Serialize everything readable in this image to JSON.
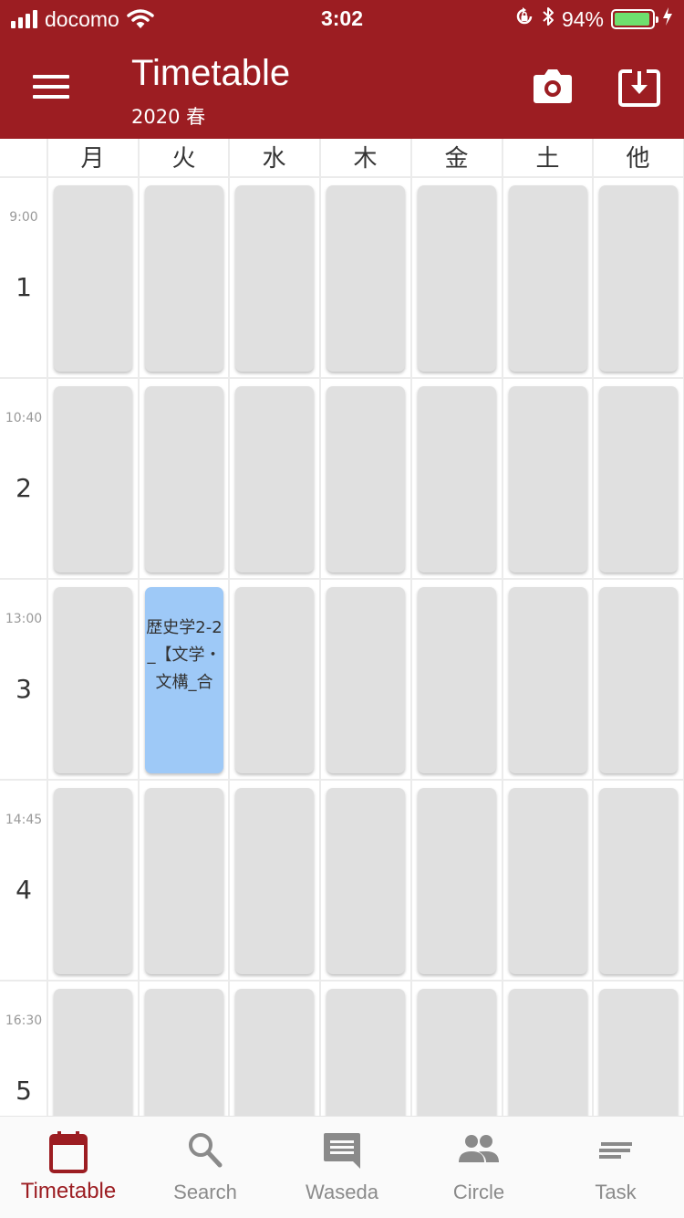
{
  "status_bar": {
    "carrier": "docomo",
    "time": "3:02",
    "battery_percent": "94%",
    "battery_level": 0.94,
    "icons": [
      "signal-icon",
      "wifi-icon",
      "rotation-lock-icon",
      "bluetooth-icon",
      "battery-icon",
      "charging-icon"
    ]
  },
  "app_bar": {
    "title": "Timetable",
    "subtitle": "2020 春",
    "background": "#9c1d22",
    "icons": [
      "menu-icon",
      "camera-icon",
      "download-icon"
    ]
  },
  "days": [
    "月",
    "火",
    "水",
    "木",
    "金",
    "土",
    "他"
  ],
  "periods": [
    {
      "number": "1",
      "start": "9:00"
    },
    {
      "number": "2",
      "start": "10:40"
    },
    {
      "number": "3",
      "start": "13:00"
    },
    {
      "number": "4",
      "start": "14:45"
    },
    {
      "number": "5",
      "start": "16:30"
    }
  ],
  "courses": [
    {
      "day": "火",
      "period": "3",
      "title": "歴史学2-2_【文学・文構_合",
      "color": "#9ec9f7"
    }
  ],
  "colors": {
    "empty_cell": "#e0e0e0",
    "accent": "#9c1d22"
  },
  "bottom_nav": [
    {
      "label": "Timetable",
      "icon": "calendar-icon",
      "active": true
    },
    {
      "label": "Search",
      "icon": "search-icon",
      "active": false
    },
    {
      "label": "Waseda",
      "icon": "message-icon",
      "active": false
    },
    {
      "label": "Circle",
      "icon": "people-icon",
      "active": false
    },
    {
      "label": "Task",
      "icon": "notes-icon",
      "active": false
    }
  ]
}
